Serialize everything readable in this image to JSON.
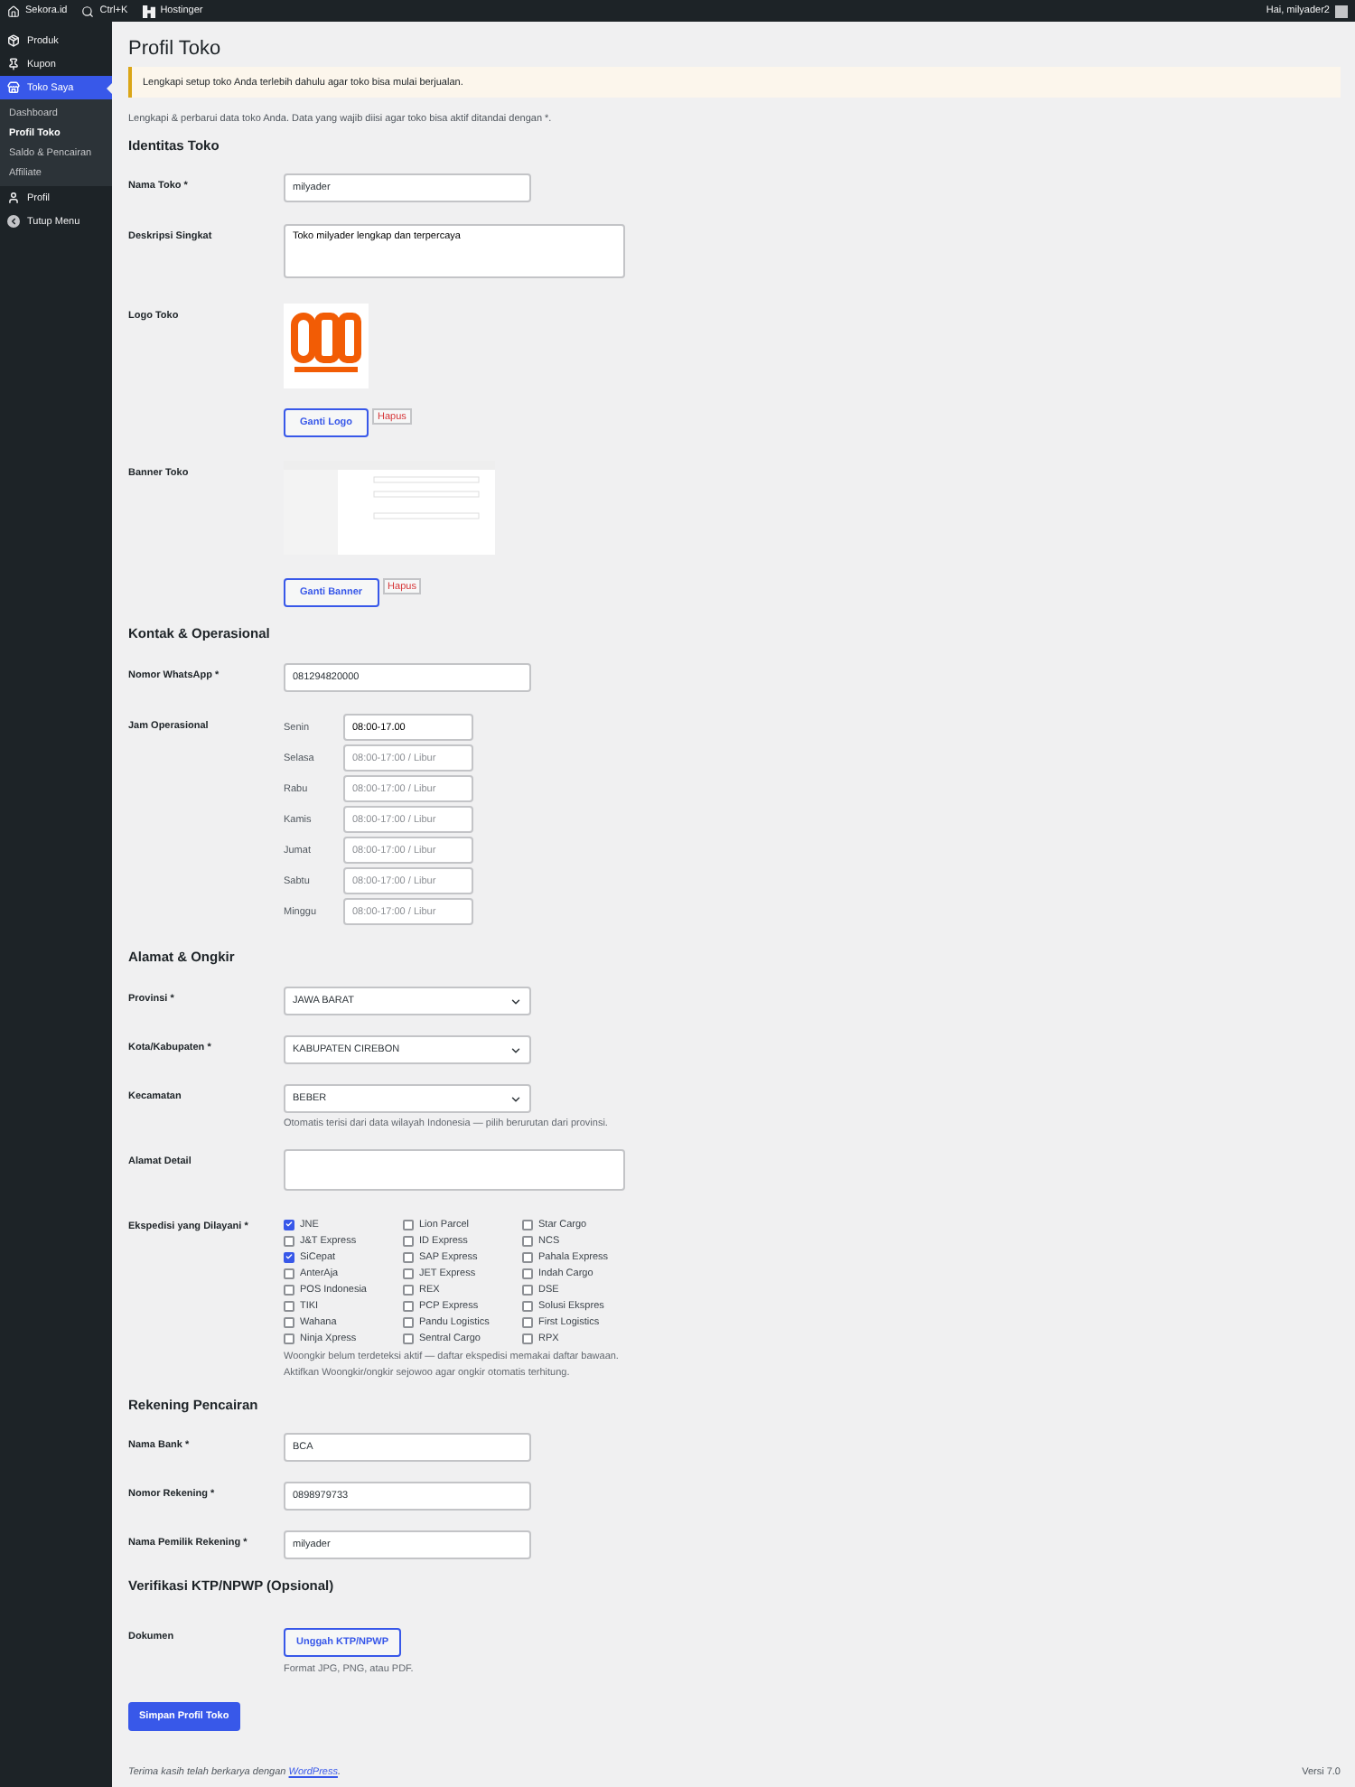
{
  "admin_bar": {
    "site": "Sekora.id",
    "search": "Ctrl+K",
    "hosting": "Hostinger",
    "greeting": "Hai, milyader2"
  },
  "sidebar": {
    "items": [
      {
        "label": "Produk",
        "selected": false
      },
      {
        "label": "Kupon",
        "selected": false
      },
      {
        "label": "Toko Saya",
        "selected": true,
        "children": [
          {
            "label": "Dashboard",
            "selected": false
          },
          {
            "label": "Profil Toko",
            "selected": true
          },
          {
            "label": "Saldo & Pencairan",
            "selected": false
          },
          {
            "label": "Affiliate",
            "selected": false
          }
        ]
      },
      {
        "label": "Profil",
        "selected": false
      },
      {
        "label": "Tutup Menu",
        "selected": false
      }
    ]
  },
  "page": {
    "title": "Profil Toko",
    "notice": "Lengkapi setup toko Anda terlebih dahulu agar toko bisa mulai berjualan.",
    "intro": "Lengkapi & perbarui data toko Anda. Data yang wajib diisi agar toko bisa aktif ditandai dengan *."
  },
  "identity": {
    "heading": "Identitas Toko",
    "name": {
      "label": "Nama Toko *",
      "value": "milyader"
    },
    "description": {
      "label": "Deskripsi Singkat",
      "value": "Toko milyader lengkap dan terpercaya"
    },
    "logo": {
      "label": "Logo Toko",
      "change": "Ganti Logo",
      "remove": "Hapus"
    },
    "banner": {
      "label": "Banner Toko",
      "change": "Ganti Banner",
      "remove": "Hapus"
    }
  },
  "contact": {
    "heading": "Kontak & Operasional",
    "whatsapp": {
      "label": "Nomor WhatsApp *",
      "value": "081294820000"
    },
    "hours_label": "Jam Operasional",
    "hours": [
      {
        "day": "Senin",
        "value": "08:00-17.00"
      },
      {
        "day": "Selasa",
        "placeholder": "08:00-17:00 / Libur"
      },
      {
        "day": "Rabu",
        "placeholder": "08:00-17:00 / Libur"
      },
      {
        "day": "Kamis",
        "placeholder": "08:00-17:00 / Libur"
      },
      {
        "day": "Jumat",
        "placeholder": "08:00-17:00 / Libur"
      },
      {
        "day": "Sabtu",
        "placeholder": "08:00-17:00 / Libur"
      },
      {
        "day": "Minggu",
        "placeholder": "08:00-17:00 / Libur"
      }
    ]
  },
  "address": {
    "heading": "Alamat & Ongkir",
    "selects": [
      {
        "label": "Provinsi *",
        "value": "JAWA BARAT"
      },
      {
        "label": "Kota/Kabupaten *",
        "value": "KABUPATEN CIREBON"
      },
      {
        "label": "Kecamatan",
        "value": "BEBER"
      }
    ],
    "hint": "Otomatis terisi dari data wilayah Indonesia — pilih berurutan dari provinsi.",
    "detail_label": "Alamat Detail",
    "couriers_label": "Ekspedisi yang Dilayani *",
    "couriers": [
      {
        "label": "JNE",
        "checked": true
      },
      {
        "label": "J&T Express",
        "checked": false
      },
      {
        "label": "SiCepat",
        "checked": true
      },
      {
        "label": "AnterAja",
        "checked": false
      },
      {
        "label": "POS Indonesia",
        "checked": false
      },
      {
        "label": "TIKI",
        "checked": false
      },
      {
        "label": "Wahana",
        "checked": false
      },
      {
        "label": "Ninja Xpress",
        "checked": false
      },
      {
        "label": "Lion Parcel",
        "checked": false
      },
      {
        "label": "ID Express",
        "checked": false
      },
      {
        "label": "SAP Express",
        "checked": false
      },
      {
        "label": "JET Express",
        "checked": false
      },
      {
        "label": "REX",
        "checked": false
      },
      {
        "label": "PCP Express",
        "checked": false
      },
      {
        "label": "Pandu Logistics",
        "checked": false
      },
      {
        "label": "Sentral Cargo",
        "checked": false
      },
      {
        "label": "Star Cargo",
        "checked": false
      },
      {
        "label": "NCS",
        "checked": false
      },
      {
        "label": "Pahala Express",
        "checked": false
      },
      {
        "label": "Indah Cargo",
        "checked": false
      },
      {
        "label": "DSE",
        "checked": false
      },
      {
        "label": "Solusi Ekspres",
        "checked": false
      },
      {
        "label": "First Logistics",
        "checked": false
      },
      {
        "label": "RPX",
        "checked": false
      }
    ],
    "note": [
      "Woongkir belum terdeteksi aktif — daftar ekspedisi memakai daftar bawaan.",
      "Aktifkan Woongkir/ongkir sejowoo agar ongkir otomatis terhitung."
    ]
  },
  "bank": {
    "heading": "Rekening Pencairan",
    "fields": [
      {
        "label": "Nama Bank *",
        "value": "BCA"
      },
      {
        "label": "Nomor Rekening *",
        "value": "0898979733"
      },
      {
        "label": "Nama Pemilik Rekening *",
        "value": "milyader"
      }
    ]
  },
  "verification": {
    "heading": "Verifikasi KTP/NPWP (Opsional)",
    "label": "Dokumen",
    "upload": "Unggah KTP/NPWP",
    "hint": "Format JPG, PNG, atau PDF."
  },
  "save": "Simpan Profil Toko",
  "footer": {
    "text_before": "Terima kasih telah berkarya dengan ",
    "link": "WordPress",
    "text_after": ".",
    "version": "Versi 7.0"
  }
}
